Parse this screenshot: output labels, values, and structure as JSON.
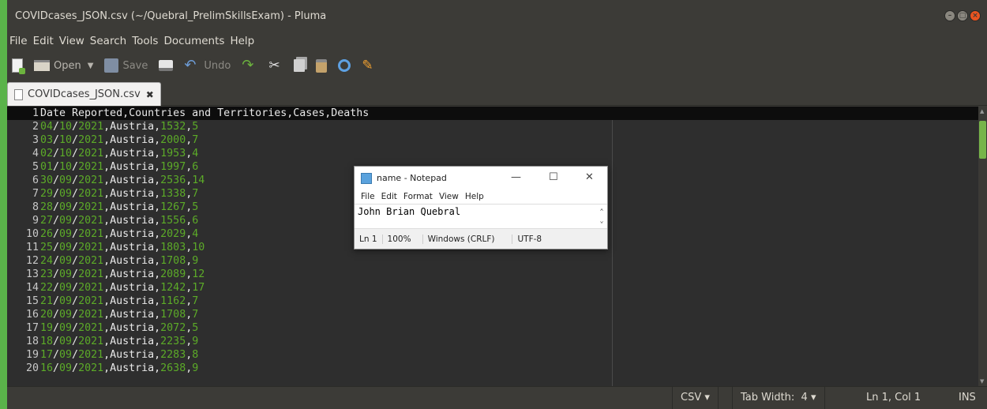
{
  "window": {
    "title": "COVIDcases_JSON.csv (~/Quebral_PrelimSkillsExam) - Pluma",
    "controls": [
      "minimize",
      "maximize",
      "close"
    ]
  },
  "menu": [
    "File",
    "Edit",
    "View",
    "Search",
    "Tools",
    "Documents",
    "Help"
  ],
  "toolbar": {
    "new_icon": "new-document-icon",
    "open_label": "Open",
    "save_label": "Save",
    "undo_label": "Undo"
  },
  "tab": {
    "label": "COVIDcases_JSON.csv",
    "close": "✖"
  },
  "editor": {
    "lines": [
      {
        "n": "1",
        "text": "Date Reported,Countries and Territories,Cases,Deaths"
      },
      {
        "n": "2",
        "d": "04",
        "m": "10",
        "y": "2021",
        "country": "Austria",
        "cases": "1532",
        "deaths": "5"
      },
      {
        "n": "3",
        "d": "03",
        "m": "10",
        "y": "2021",
        "country": "Austria",
        "cases": "2000",
        "deaths": "7"
      },
      {
        "n": "4",
        "d": "02",
        "m": "10",
        "y": "2021",
        "country": "Austria",
        "cases": "1953",
        "deaths": "4"
      },
      {
        "n": "5",
        "d": "01",
        "m": "10",
        "y": "2021",
        "country": "Austria",
        "cases": "1997",
        "deaths": "6"
      },
      {
        "n": "6",
        "d": "30",
        "m": "09",
        "y": "2021",
        "country": "Austria",
        "cases": "2536",
        "deaths": "14"
      },
      {
        "n": "7",
        "d": "29",
        "m": "09",
        "y": "2021",
        "country": "Austria",
        "cases": "1338",
        "deaths": "7"
      },
      {
        "n": "8",
        "d": "28",
        "m": "09",
        "y": "2021",
        "country": "Austria",
        "cases": "1267",
        "deaths": "5"
      },
      {
        "n": "9",
        "d": "27",
        "m": "09",
        "y": "2021",
        "country": "Austria",
        "cases": "1556",
        "deaths": "6"
      },
      {
        "n": "10",
        "d": "26",
        "m": "09",
        "y": "2021",
        "country": "Austria",
        "cases": "2029",
        "deaths": "4"
      },
      {
        "n": "11",
        "d": "25",
        "m": "09",
        "y": "2021",
        "country": "Austria",
        "cases": "1803",
        "deaths": "10"
      },
      {
        "n": "12",
        "d": "24",
        "m": "09",
        "y": "2021",
        "country": "Austria",
        "cases": "1708",
        "deaths": "9"
      },
      {
        "n": "13",
        "d": "23",
        "m": "09",
        "y": "2021",
        "country": "Austria",
        "cases": "2089",
        "deaths": "12"
      },
      {
        "n": "14",
        "d": "22",
        "m": "09",
        "y": "2021",
        "country": "Austria",
        "cases": "1242",
        "deaths": "17"
      },
      {
        "n": "15",
        "d": "21",
        "m": "09",
        "y": "2021",
        "country": "Austria",
        "cases": "1162",
        "deaths": "7"
      },
      {
        "n": "16",
        "d": "20",
        "m": "09",
        "y": "2021",
        "country": "Austria",
        "cases": "1708",
        "deaths": "7"
      },
      {
        "n": "17",
        "d": "19",
        "m": "09",
        "y": "2021",
        "country": "Austria",
        "cases": "2072",
        "deaths": "5"
      },
      {
        "n": "18",
        "d": "18",
        "m": "09",
        "y": "2021",
        "country": "Austria",
        "cases": "2235",
        "deaths": "9"
      },
      {
        "n": "19",
        "d": "17",
        "m": "09",
        "y": "2021",
        "country": "Austria",
        "cases": "2283",
        "deaths": "8"
      },
      {
        "n": "20",
        "d": "16",
        "m": "09",
        "y": "2021",
        "country": "Austria",
        "cases": "2638",
        "deaths": "9"
      }
    ]
  },
  "statusbar": {
    "language": "CSV",
    "tab_width": "Tab Width:  4",
    "position": "Ln 1, Col 1",
    "mode": "INS"
  },
  "notepad": {
    "title": "name - Notepad",
    "menu": [
      "File",
      "Edit",
      "Format",
      "View",
      "Help"
    ],
    "content": "John Brian Quebral",
    "status": {
      "line": "Ln 1",
      "zoom": "100%",
      "eol": "Windows (CRLF)",
      "encoding": "UTF-8"
    }
  },
  "colors": {
    "editor_bg": "#2e2e2e",
    "number": "#5cab28",
    "text": "#e8e8e8",
    "accent_green": "#5ab34a",
    "close_orange": "#e95420"
  }
}
